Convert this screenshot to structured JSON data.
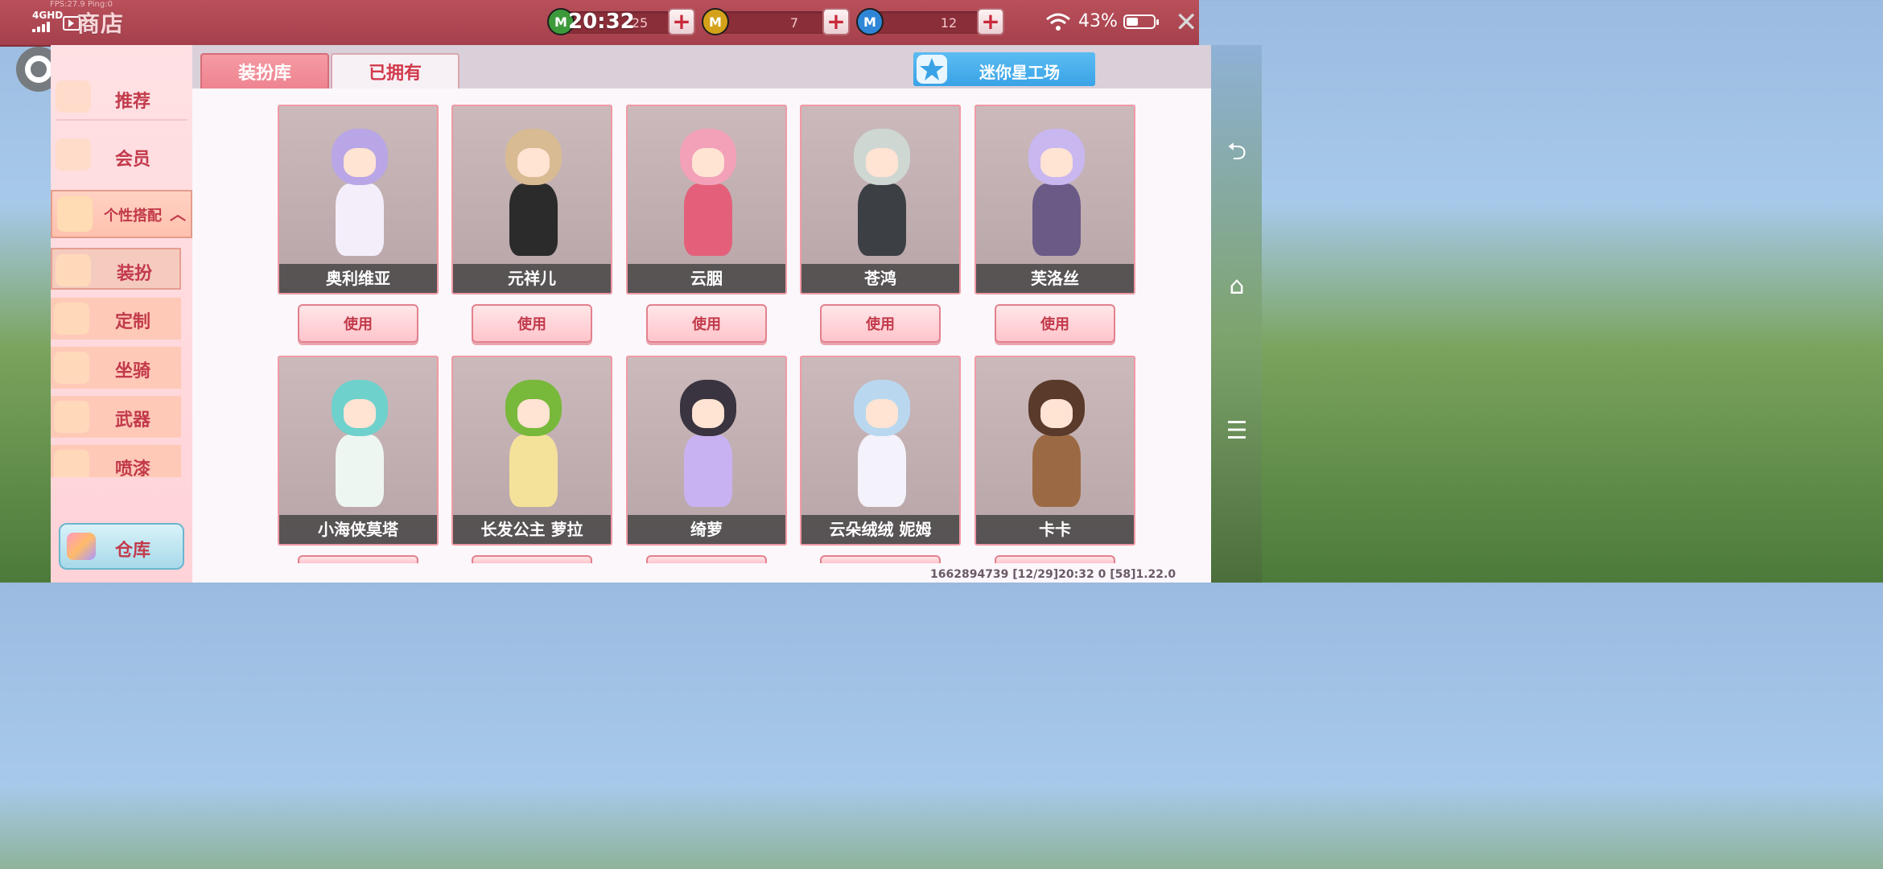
{
  "status_bar": {
    "fps_text": "FPS:27.9  Ping:0",
    "network": "4GHD",
    "time": "20:32",
    "battery_percent": "43%",
    "battery_level": 0.43
  },
  "top_bar": {
    "title": "商店",
    "currencies": [
      {
        "icon": "green-mini-coin-icon",
        "letter": "M",
        "value": "25",
        "color": "#3c9a3a"
      },
      {
        "icon": "gold-mini-coin-icon",
        "letter": "M",
        "value": "7",
        "color": "#d4a21a"
      },
      {
        "icon": "blue-mini-coin-icon",
        "letter": "M",
        "value": "12",
        "color": "#2f86d6"
      }
    ],
    "plus_label": "+",
    "close_label": "✕"
  },
  "sidebar": {
    "items": [
      {
        "label": "推荐",
        "icon": "recommend-icon"
      },
      {
        "label": "会员",
        "icon": "member-icon"
      }
    ],
    "group": {
      "label": "个性搭配",
      "arrow": "︿"
    },
    "sub_items": [
      {
        "label": "装扮",
        "icon": "dressup-icon"
      },
      {
        "label": "定制",
        "icon": "customize-icon"
      },
      {
        "label": "坐骑",
        "icon": "mount-icon"
      },
      {
        "label": "武器",
        "icon": "weapon-icon"
      },
      {
        "label": "喷漆",
        "icon": "spray-paint-icon"
      }
    ],
    "warehouse": "仓库"
  },
  "tabs": {
    "wardrobe": "装扮库",
    "owned": "已拥有"
  },
  "workshop_button": "迷你星工场",
  "use_label": "使用",
  "skins": [
    {
      "name": "奥利维亚",
      "hair": "#b9a6e6",
      "outfit": "#f3eefa"
    },
    {
      "name": "元祥儿",
      "hair": "#d9bb93",
      "outfit": "#2b2b2b"
    },
    {
      "name": "云胭",
      "hair": "#f2a1b8",
      "outfit": "#e4607a"
    },
    {
      "name": "苍鸿",
      "hair": "#cfd7d2",
      "outfit": "#3c3f44"
    },
    {
      "name": "芙洛丝",
      "hair": "#c9b7f0",
      "outfit": "#6a5a86"
    },
    {
      "name": "小海侠莫塔",
      "hair": "#6fd1cc",
      "outfit": "#eef6f2"
    },
    {
      "name": "长发公主 萝拉",
      "hair": "#78b83a",
      "outfit": "#f5e29a"
    },
    {
      "name": "绮萝",
      "hair": "#3a3440",
      "outfit": "#c9b2f2"
    },
    {
      "name": "云朵绒绒 妮姆",
      "hair": "#b9d8f0",
      "outfit": "#f4f2fb"
    },
    {
      "name": "卡卡",
      "hair": "#5a3a2a",
      "outfit": "#9b6a44"
    }
  ],
  "footer": "1662894739  [12/29]20:32 0  [58]1.22.0"
}
